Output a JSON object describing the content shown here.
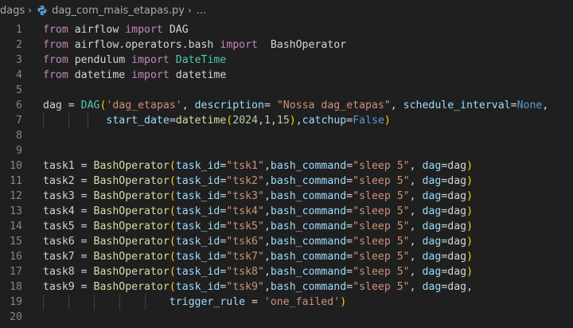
{
  "breadcrumb": {
    "folder": "dags",
    "file": "dag_com_mais_etapas.py",
    "ellipsis": "..."
  },
  "colors": {
    "background": "#1f1f1f",
    "keyword": "#c586c0",
    "class": "#4ec9b0",
    "string": "#ce9178",
    "parameter": "#9cdcfe",
    "number": "#b5cea8",
    "constant": "#569cd6",
    "bracket": "#ffd700"
  },
  "editor": {
    "lines": [
      {
        "n": "1",
        "tokens": [
          [
            "kw",
            "from"
          ],
          [
            "plain",
            " airflow "
          ],
          [
            "kw",
            "import"
          ],
          [
            "plain",
            " DAG"
          ]
        ]
      },
      {
        "n": "2",
        "tokens": [
          [
            "kw",
            "from"
          ],
          [
            "plain",
            " airflow.operators.bash "
          ],
          [
            "kw",
            "import"
          ],
          [
            "plain",
            "  BashOperator"
          ]
        ]
      },
      {
        "n": "3",
        "tokens": [
          [
            "kw",
            "from"
          ],
          [
            "plain",
            " pendulum "
          ],
          [
            "kw",
            "import"
          ],
          [
            "cls",
            " DateTime"
          ]
        ]
      },
      {
        "n": "4",
        "tokens": [
          [
            "kw",
            "from"
          ],
          [
            "plain",
            " datetime "
          ],
          [
            "kw",
            "import"
          ],
          [
            "plain",
            " datetime"
          ]
        ]
      },
      {
        "n": "5",
        "tokens": []
      },
      {
        "n": "6",
        "tokens": [
          [
            "plain",
            "dag = "
          ],
          [
            "cls",
            "DAG"
          ],
          [
            "par",
            "("
          ],
          [
            "str",
            "'dag_etapas'"
          ],
          [
            "plain",
            ", "
          ],
          [
            "prm",
            "description"
          ],
          [
            "plain",
            "= "
          ],
          [
            "str",
            "\"Nossa dag_etapas\""
          ],
          [
            "plain",
            ", "
          ],
          [
            "prm",
            "schedule_interval"
          ],
          [
            "plain",
            "="
          ],
          [
            "const",
            "None"
          ],
          [
            "plain",
            ","
          ]
        ]
      },
      {
        "n": "7",
        "guides": [
          54,
          86,
          110
        ],
        "tokens": [
          [
            "plain",
            "          "
          ],
          [
            "prm",
            "start_date"
          ],
          [
            "plain",
            "="
          ],
          [
            "fn",
            "datetime"
          ],
          [
            "par",
            "("
          ],
          [
            "num",
            "2024"
          ],
          [
            "plain",
            ","
          ],
          [
            "num",
            "1"
          ],
          [
            "plain",
            ","
          ],
          [
            "num",
            "15"
          ],
          [
            "par",
            ")"
          ],
          [
            "plain",
            ","
          ],
          [
            "prm",
            "catchup"
          ],
          [
            "plain",
            "="
          ],
          [
            "const",
            "False"
          ],
          [
            "par",
            ")"
          ]
        ]
      },
      {
        "n": "8",
        "tokens": []
      },
      {
        "n": "9",
        "tokens": []
      },
      {
        "n": "10",
        "tokens": [
          [
            "plain",
            "task1 = "
          ],
          [
            "fn",
            "BashOperator"
          ],
          [
            "par",
            "("
          ],
          [
            "prm",
            "task_id"
          ],
          [
            "plain",
            "="
          ],
          [
            "str",
            "\"tsk1\""
          ],
          [
            "plain",
            ","
          ],
          [
            "prm",
            "bash_command"
          ],
          [
            "plain",
            "="
          ],
          [
            "str",
            "\"sleep 5\""
          ],
          [
            "plain",
            ", "
          ],
          [
            "prm",
            "dag"
          ],
          [
            "plain",
            "=dag"
          ],
          [
            "par",
            ")"
          ]
        ]
      },
      {
        "n": "11",
        "tokens": [
          [
            "plain",
            "task2 = "
          ],
          [
            "fn",
            "BashOperator"
          ],
          [
            "par",
            "("
          ],
          [
            "prm",
            "task_id"
          ],
          [
            "plain",
            "="
          ],
          [
            "str",
            "\"tsk2\""
          ],
          [
            "plain",
            ","
          ],
          [
            "prm",
            "bash_command"
          ],
          [
            "plain",
            "="
          ],
          [
            "str",
            "\"sleep 5\""
          ],
          [
            "plain",
            ", "
          ],
          [
            "prm",
            "dag"
          ],
          [
            "plain",
            "=dag"
          ],
          [
            "par",
            ")"
          ]
        ]
      },
      {
        "n": "12",
        "tokens": [
          [
            "plain",
            "task3 = "
          ],
          [
            "fn",
            "BashOperator"
          ],
          [
            "par",
            "("
          ],
          [
            "prm",
            "task_id"
          ],
          [
            "plain",
            "="
          ],
          [
            "str",
            "\"tsk3\""
          ],
          [
            "plain",
            ","
          ],
          [
            "prm",
            "bash_command"
          ],
          [
            "plain",
            "="
          ],
          [
            "str",
            "\"sleep 5\""
          ],
          [
            "plain",
            ", "
          ],
          [
            "prm",
            "dag"
          ],
          [
            "plain",
            "=dag"
          ],
          [
            "par",
            ")"
          ]
        ]
      },
      {
        "n": "13",
        "tokens": [
          [
            "plain",
            "task4 = "
          ],
          [
            "fn",
            "BashOperator"
          ],
          [
            "par",
            "("
          ],
          [
            "prm",
            "task_id"
          ],
          [
            "plain",
            "="
          ],
          [
            "str",
            "\"tsk4\""
          ],
          [
            "plain",
            ","
          ],
          [
            "prm",
            "bash_command"
          ],
          [
            "plain",
            "="
          ],
          [
            "str",
            "\"sleep 5\""
          ],
          [
            "plain",
            ", "
          ],
          [
            "prm",
            "dag"
          ],
          [
            "plain",
            "=dag"
          ],
          [
            "par",
            ")"
          ]
        ]
      },
      {
        "n": "14",
        "tokens": [
          [
            "plain",
            "task5 = "
          ],
          [
            "fn",
            "BashOperator"
          ],
          [
            "par",
            "("
          ],
          [
            "prm",
            "task_id"
          ],
          [
            "plain",
            "="
          ],
          [
            "str",
            "\"tsk5\""
          ],
          [
            "plain",
            ","
          ],
          [
            "prm",
            "bash_command"
          ],
          [
            "plain",
            "="
          ],
          [
            "str",
            "\"sleep 5\""
          ],
          [
            "plain",
            ", "
          ],
          [
            "prm",
            "dag"
          ],
          [
            "plain",
            "=dag"
          ],
          [
            "par",
            ")"
          ]
        ]
      },
      {
        "n": "15",
        "tokens": [
          [
            "plain",
            "task6 = "
          ],
          [
            "fn",
            "BashOperator"
          ],
          [
            "par",
            "("
          ],
          [
            "prm",
            "task_id"
          ],
          [
            "plain",
            "="
          ],
          [
            "str",
            "\"tsk6\""
          ],
          [
            "plain",
            ","
          ],
          [
            "prm",
            "bash_command"
          ],
          [
            "plain",
            "="
          ],
          [
            "str",
            "\"sleep 5\""
          ],
          [
            "plain",
            ", "
          ],
          [
            "prm",
            "dag"
          ],
          [
            "plain",
            "=dag"
          ],
          [
            "par",
            ")"
          ]
        ]
      },
      {
        "n": "16",
        "tokens": [
          [
            "plain",
            "task7 = "
          ],
          [
            "fn",
            "BashOperator"
          ],
          [
            "par",
            "("
          ],
          [
            "prm",
            "task_id"
          ],
          [
            "plain",
            "="
          ],
          [
            "str",
            "\"tsk7\""
          ],
          [
            "plain",
            ","
          ],
          [
            "prm",
            "bash_command"
          ],
          [
            "plain",
            "="
          ],
          [
            "str",
            "\"sleep 5\""
          ],
          [
            "plain",
            ", "
          ],
          [
            "prm",
            "dag"
          ],
          [
            "plain",
            "=dag"
          ],
          [
            "par",
            ")"
          ]
        ]
      },
      {
        "n": "17",
        "tokens": [
          [
            "plain",
            "task8 = "
          ],
          [
            "fn",
            "BashOperator"
          ],
          [
            "par",
            "("
          ],
          [
            "prm",
            "task_id"
          ],
          [
            "plain",
            "="
          ],
          [
            "str",
            "\"tsk8\""
          ],
          [
            "plain",
            ","
          ],
          [
            "prm",
            "bash_command"
          ],
          [
            "plain",
            "="
          ],
          [
            "str",
            "\"sleep 5\""
          ],
          [
            "plain",
            ", "
          ],
          [
            "prm",
            "dag"
          ],
          [
            "plain",
            "=dag"
          ],
          [
            "par",
            ")"
          ]
        ]
      },
      {
        "n": "18",
        "tokens": [
          [
            "plain",
            "task9 = "
          ],
          [
            "fn",
            "BashOperator"
          ],
          [
            "par",
            "("
          ],
          [
            "prm",
            "task_id"
          ],
          [
            "plain",
            "="
          ],
          [
            "str",
            "\"tsk9\""
          ],
          [
            "plain",
            ","
          ],
          [
            "prm",
            "bash_command"
          ],
          [
            "plain",
            "="
          ],
          [
            "str",
            "\"sleep 5\""
          ],
          [
            "plain",
            ", "
          ],
          [
            "prm",
            "dag"
          ],
          [
            "plain",
            "=dag,"
          ]
        ]
      },
      {
        "n": "19",
        "guides": [
          54,
          86,
          118,
          150,
          182
        ],
        "tokens": [
          [
            "plain",
            "                    "
          ],
          [
            "prm",
            "trigger_rule"
          ],
          [
            "plain",
            " = "
          ],
          [
            "str",
            "'one_failed'"
          ],
          [
            "par",
            ")"
          ]
        ]
      },
      {
        "n": "20",
        "tokens": []
      }
    ]
  }
}
